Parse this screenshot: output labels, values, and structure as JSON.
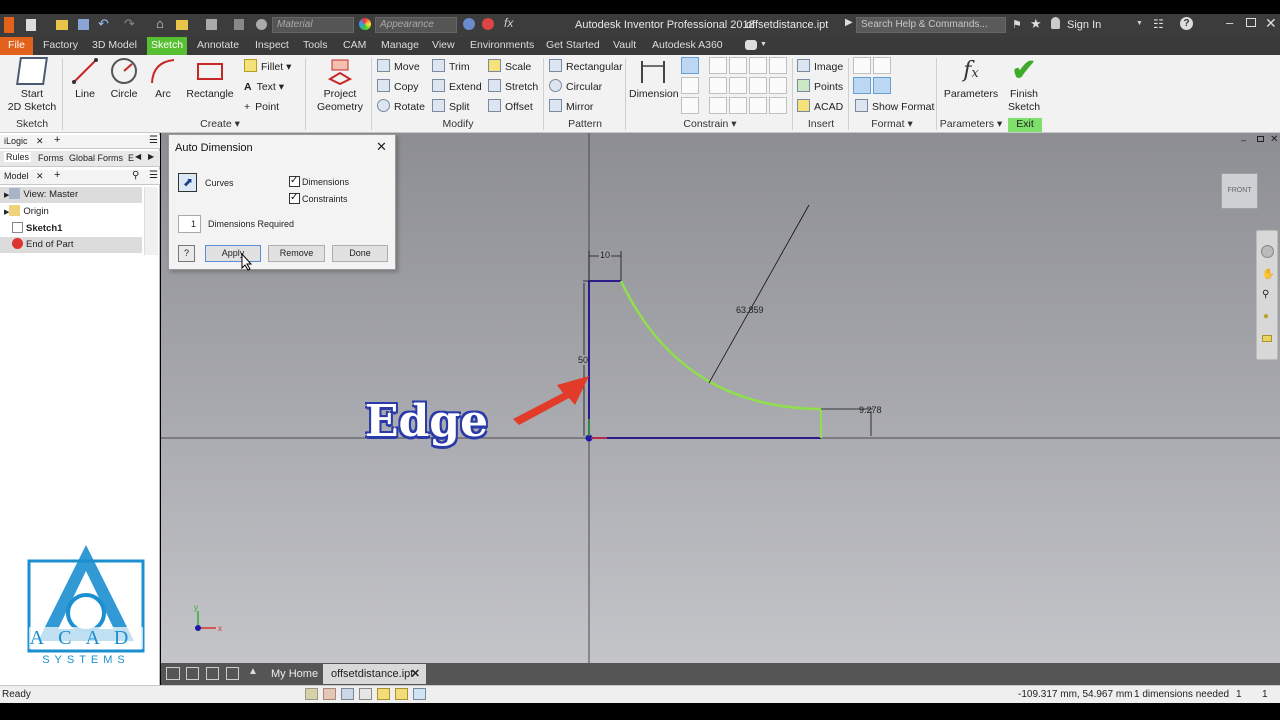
{
  "app": {
    "title": "Autodesk Inventor Professional 2018",
    "document": "offsetdistance.ipt",
    "search_placeholder": "Search Help & Commands...",
    "sign_in": "Sign In",
    "material_placeholder": "Material",
    "appearance_placeholder": "Appearance"
  },
  "menu": [
    "File",
    "Factory",
    "3D Model",
    "Sketch",
    "Annotate",
    "Inspect",
    "Tools",
    "CAM",
    "Manage",
    "View",
    "Environments",
    "Get Started",
    "Vault",
    "Autodesk A360"
  ],
  "ribbon": {
    "start_sketch": "Start\n2D Sketch",
    "line": "Line",
    "circle": "Circle",
    "arc": "Arc",
    "rectangle": "Rectangle",
    "fillet": "Fillet",
    "text": "Text",
    "point": "Point",
    "project_geometry": "Project\nGeometry",
    "move": "Move",
    "copy": "Copy",
    "rotate": "Rotate",
    "trim": "Trim",
    "extend": "Extend",
    "split": "Split",
    "scale": "Scale",
    "stretch": "Stretch",
    "offset": "Offset",
    "rect_pattern": "Rectangular",
    "circ_pattern": "Circular",
    "mirror": "Mirror",
    "dimension": "Dimension",
    "image": "Image",
    "points": "Points",
    "acad": "ACAD",
    "show_format": "Show Format",
    "parameters": "Parameters",
    "finish_sketch": "Finish\nSketch",
    "panels": {
      "sketch": "Sketch",
      "create": "Create",
      "modify": "Modify",
      "pattern": "Pattern",
      "constrain": "Constrain",
      "insert": "Insert",
      "format": "Format",
      "parameters": "Parameters",
      "exit": "Exit"
    }
  },
  "browser": {
    "tab_ilogic": "iLogic",
    "subtabs": [
      "Rules",
      "Forms",
      "Global Forms",
      "E"
    ],
    "tab_model": "Model",
    "tree": [
      "View: Master",
      "Origin",
      "Sketch1",
      "End of Part"
    ]
  },
  "dialog": {
    "title": "Auto Dimension",
    "curves_label": "Curves",
    "dimensions_check": "Dimensions",
    "constraints_check": "Constraints",
    "required_count": "1",
    "required_label": "Dimensions Required",
    "apply": "Apply",
    "remove": "Remove",
    "done": "Done"
  },
  "sketch": {
    "dim_top": "10",
    "dim_left": "50",
    "dim_radius": "63.859",
    "dim_right": "9.278"
  },
  "viewcube_label": "FRONT",
  "overlay_label": "Edge",
  "logo": {
    "letters": "ACAD",
    "sub": "SYSTEMS"
  },
  "doc_tabs": [
    "My Home",
    "offsetdistance.ipt"
  ],
  "status": {
    "left": "Ready",
    "coords": "-109.317 mm, 54.967 mm",
    "needed": "1 dimensions needed",
    "n1": "1",
    "n2": "1"
  },
  "colors": {
    "file_tab": "#e2621b",
    "active_tab": "#57c032",
    "sketch_line": "#2a1a8a",
    "arc_green": "#8fe04a",
    "arrow_red": "#e23b2a",
    "logo_blue": "#1b8fd0"
  }
}
